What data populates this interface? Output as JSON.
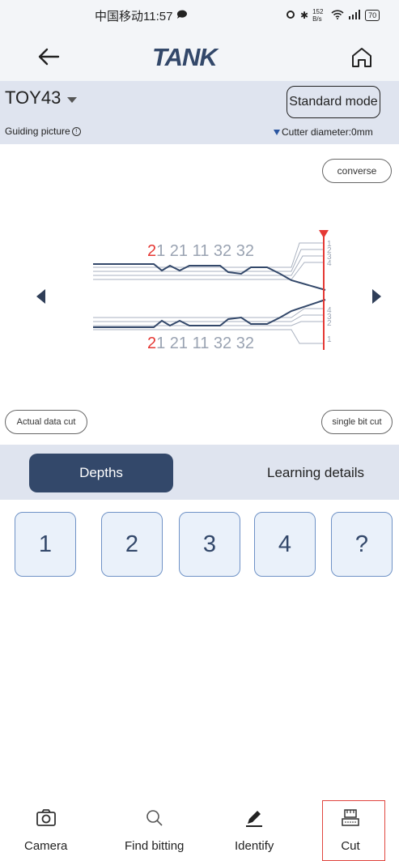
{
  "status_bar": {
    "carrier_time": "中国移动11:57",
    "right_indicators": "152 B/s",
    "battery": "70"
  },
  "header": {
    "logo": "TANK",
    "back_icon": "arrow-left-icon",
    "home_icon": "home-icon"
  },
  "info": {
    "model": "TOY43",
    "mode_button": "Standard mode",
    "guide_label": "Guiding picture",
    "cutter_label": "Cutter diameter:0mm"
  },
  "diagram": {
    "converse_button": "converse",
    "top_code_first": "2",
    "top_code_rest": "1 21 11 32 32",
    "bottom_code_first": "2",
    "bottom_code_rest": "1 21 11 32 32",
    "depth_labels": [
      "1",
      "2",
      "3",
      "4"
    ],
    "actual_data_button": "Actual data cut",
    "single_bit_button": "single bit cut",
    "colors": {
      "accent_red": "#e53935",
      "key_line": "#33486a",
      "code_grey": "#9aa3b2"
    }
  },
  "tabs": {
    "depths": "Depths",
    "learning": "Learning details"
  },
  "depth_buttons": [
    "1",
    "2",
    "3",
    "4",
    "?"
  ],
  "bottom_nav": {
    "camera": "Camera",
    "find_bitting": "Find bitting",
    "identify": "Identify",
    "cut": "Cut"
  }
}
